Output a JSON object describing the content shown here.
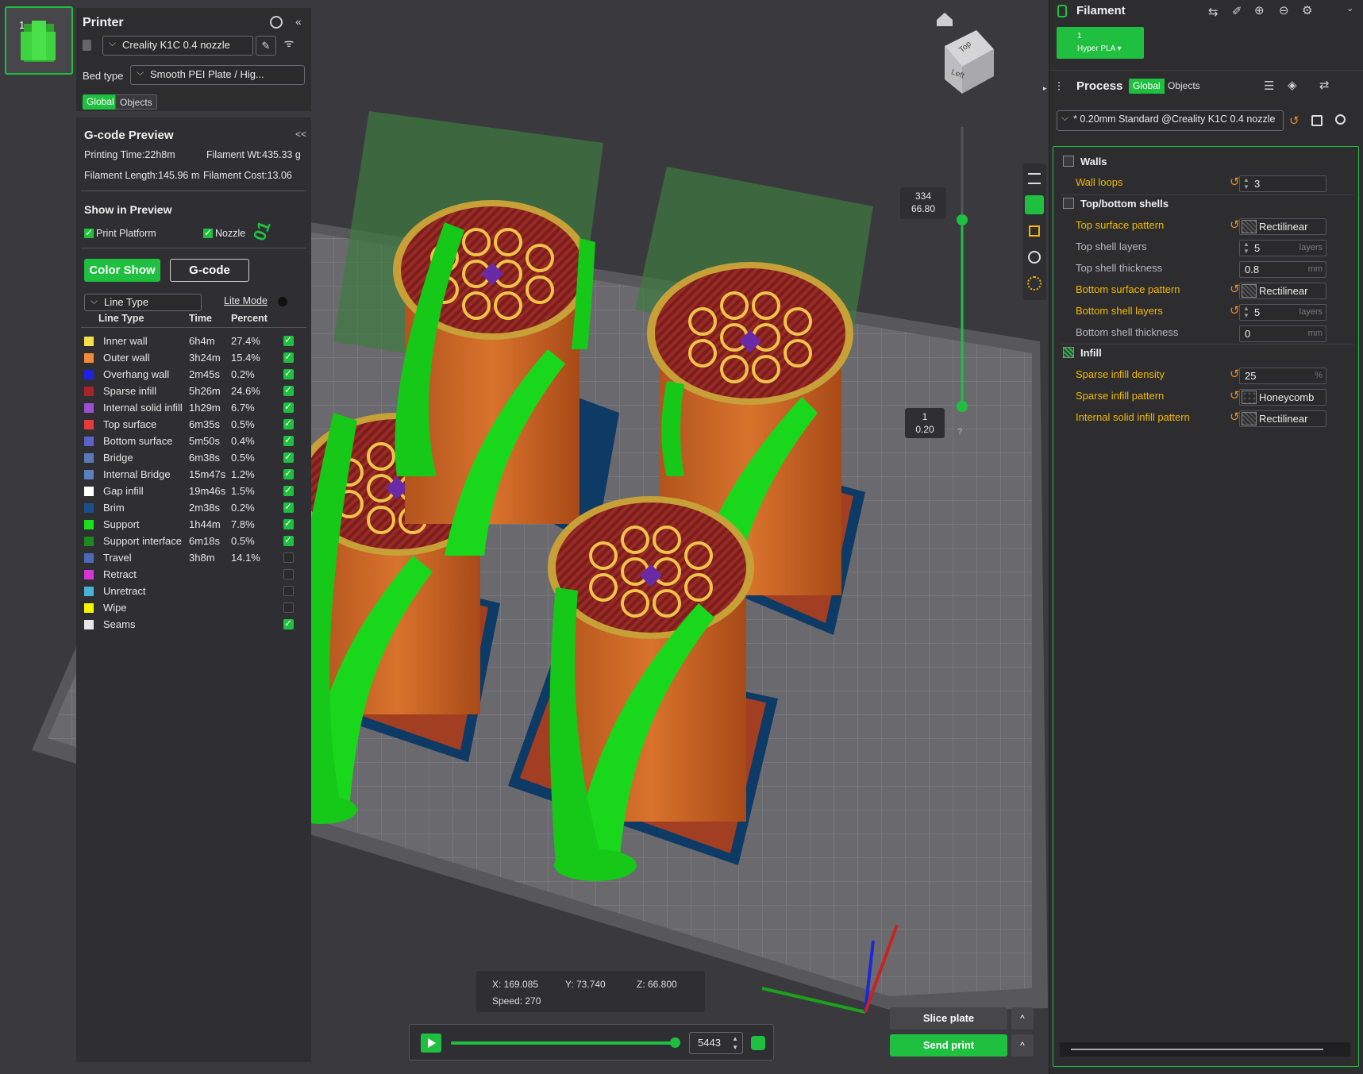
{
  "plate": {
    "number": "1"
  },
  "printer": {
    "title": "Printer",
    "model": "Creality K1C 0.4 nozzle",
    "bed_type_label": "Bed type",
    "bed_type": "Smooth PEI Plate / Hig...",
    "tab_global": "Global",
    "tab_objects": "Objects"
  },
  "gcode_preview": {
    "title": "G-code Preview",
    "collapse": "<<",
    "printing_time": "Printing Time:22h8m",
    "filament_wt": "Filament Wt:435.33 g",
    "filament_length": "Filament Length:145.96 m",
    "filament_cost": "Filament Cost:13.06",
    "show_in_preview": "Show in Preview",
    "print_platform": "Print Platform",
    "nozzle": "Nozzle",
    "color_show": "Color Show",
    "gcode_btn": "G-code",
    "line_type_select": "Line Type",
    "lite_mode": "Lite Mode",
    "col_line_type": "Line Type",
    "col_time": "Time",
    "col_percent": "Percent"
  },
  "legend": [
    {
      "name": "Inner wall",
      "time": "6h4m",
      "percent": "27.4%",
      "color": "#f6e04a",
      "checked": true
    },
    {
      "name": "Outer wall",
      "time": "3h24m",
      "percent": "15.4%",
      "color": "#f28a3a",
      "checked": true
    },
    {
      "name": "Overhang wall",
      "time": "2m45s",
      "percent": "0.2%",
      "color": "#1e22e8",
      "checked": true
    },
    {
      "name": "Sparse infill",
      "time": "5h26m",
      "percent": "24.6%",
      "color": "#a8242a",
      "checked": true
    },
    {
      "name": "Internal solid infill",
      "time": "1h29m",
      "percent": "6.7%",
      "color": "#9d4fd0",
      "checked": true
    },
    {
      "name": "Top surface",
      "time": "6m35s",
      "percent": "0.5%",
      "color": "#e63a3a",
      "checked": true
    },
    {
      "name": "Bottom surface",
      "time": "5m50s",
      "percent": "0.4%",
      "color": "#5a62c8",
      "checked": true
    },
    {
      "name": "Bridge",
      "time": "6m38s",
      "percent": "0.5%",
      "color": "#5a78b8",
      "checked": true
    },
    {
      "name": "Internal Bridge",
      "time": "15m47s",
      "percent": "1.2%",
      "color": "#5a80c0",
      "checked": true
    },
    {
      "name": "Gap infill",
      "time": "19m46s",
      "percent": "1.5%",
      "color": "#ffffff",
      "checked": true
    },
    {
      "name": "Brim",
      "time": "2m38s",
      "percent": "0.2%",
      "color": "#1b4e8c",
      "checked": true
    },
    {
      "name": "Support",
      "time": "1h44m",
      "percent": "7.8%",
      "color": "#19e01c",
      "checked": true
    },
    {
      "name": "Support interface",
      "time": "6m18s",
      "percent": "0.5%",
      "color": "#1c8a1c",
      "checked": true
    },
    {
      "name": "Travel",
      "time": "3h8m",
      "percent": "14.1%",
      "color": "#4a6ab8",
      "checked": false
    },
    {
      "name": "Retract",
      "time": "",
      "percent": "",
      "color": "#d634d6",
      "checked": false
    },
    {
      "name": "Unretract",
      "time": "",
      "percent": "",
      "color": "#4ab2d8",
      "checked": false
    },
    {
      "name": "Wipe",
      "time": "",
      "percent": "",
      "color": "#f5f500",
      "checked": false
    },
    {
      "name": "Seams",
      "time": "",
      "percent": "",
      "color": "#e6e6e6",
      "checked": true
    }
  ],
  "viewport": {
    "layer_top_value": "334",
    "layer_top_height": "66.80",
    "layer_bottom_value": "1",
    "layer_bottom_height": "0.20",
    "help": "?",
    "coord_x": "X: 169.085",
    "coord_y": "Y: 73.740",
    "coord_z": "Z: 66.800",
    "speed": "Speed: 270",
    "move_value": "5443",
    "view_cube_top": "Top",
    "view_cube_left": "Left",
    "tag_marker": "01"
  },
  "actions": {
    "slice_plate": "Slice plate",
    "send_print": "Send print",
    "caret": "^"
  },
  "filament": {
    "title": "Filament",
    "slot_number": "1",
    "slot_name": "Hyper PLA ▾"
  },
  "process": {
    "title": "Process",
    "tab_global": "Global",
    "tab_objects": "Objects",
    "profile": "* 0.20mm Standard @Creality K1C 0.4 nozzle",
    "sections": {
      "walls": "Walls",
      "top_bottom": "Top/bottom shells",
      "infill": "Infill"
    },
    "settings": {
      "wall_loops": {
        "label": "Wall loops",
        "value": "3",
        "unit": ""
      },
      "top_surface_pattern": {
        "label": "Top surface pattern",
        "value": "Rectilinear"
      },
      "top_shell_layers": {
        "label": "Top shell layers",
        "value": "5",
        "unit": "layers"
      },
      "top_shell_thickness": {
        "label": "Top shell thickness",
        "value": "0.8",
        "unit": "mm"
      },
      "bottom_surface_pattern": {
        "label": "Bottom surface pattern",
        "value": "Rectilinear"
      },
      "bottom_shell_layers": {
        "label": "Bottom shell layers",
        "value": "5",
        "unit": "layers"
      },
      "bottom_shell_thickness": {
        "label": "Bottom shell thickness",
        "value": "0",
        "unit": "mm"
      },
      "sparse_infill_density": {
        "label": "Sparse infill density",
        "value": "25",
        "unit": "%"
      },
      "sparse_infill_pattern": {
        "label": "Sparse infill pattern",
        "value": "Honeycomb"
      },
      "internal_solid_infill_pattern": {
        "label": "Internal solid infill pattern",
        "value": "Rectilinear"
      }
    }
  },
  "colors": {
    "accent": "#1fbf3f",
    "warning": "#f2b800",
    "reset": "#e88a2a"
  }
}
